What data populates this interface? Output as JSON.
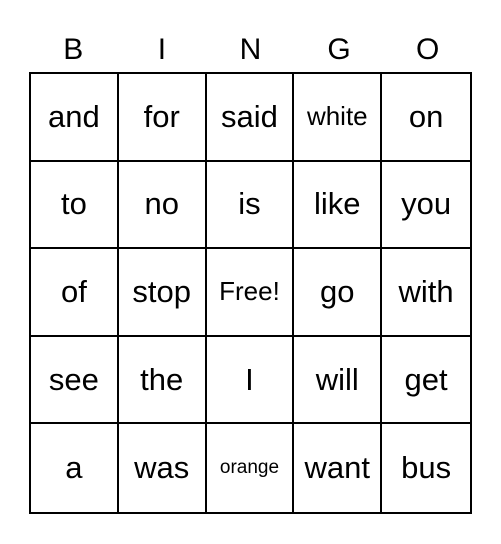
{
  "header": [
    "B",
    "I",
    "N",
    "G",
    "O"
  ],
  "rows": [
    [
      "and",
      "for",
      "said",
      "white",
      "on"
    ],
    [
      "to",
      "no",
      "is",
      "like",
      "you"
    ],
    [
      "of",
      "stop",
      "Free!",
      "go",
      "with"
    ],
    [
      "see",
      "the",
      "I",
      "will",
      "get"
    ],
    [
      "a",
      "was",
      "orange",
      "want",
      "bus"
    ]
  ]
}
